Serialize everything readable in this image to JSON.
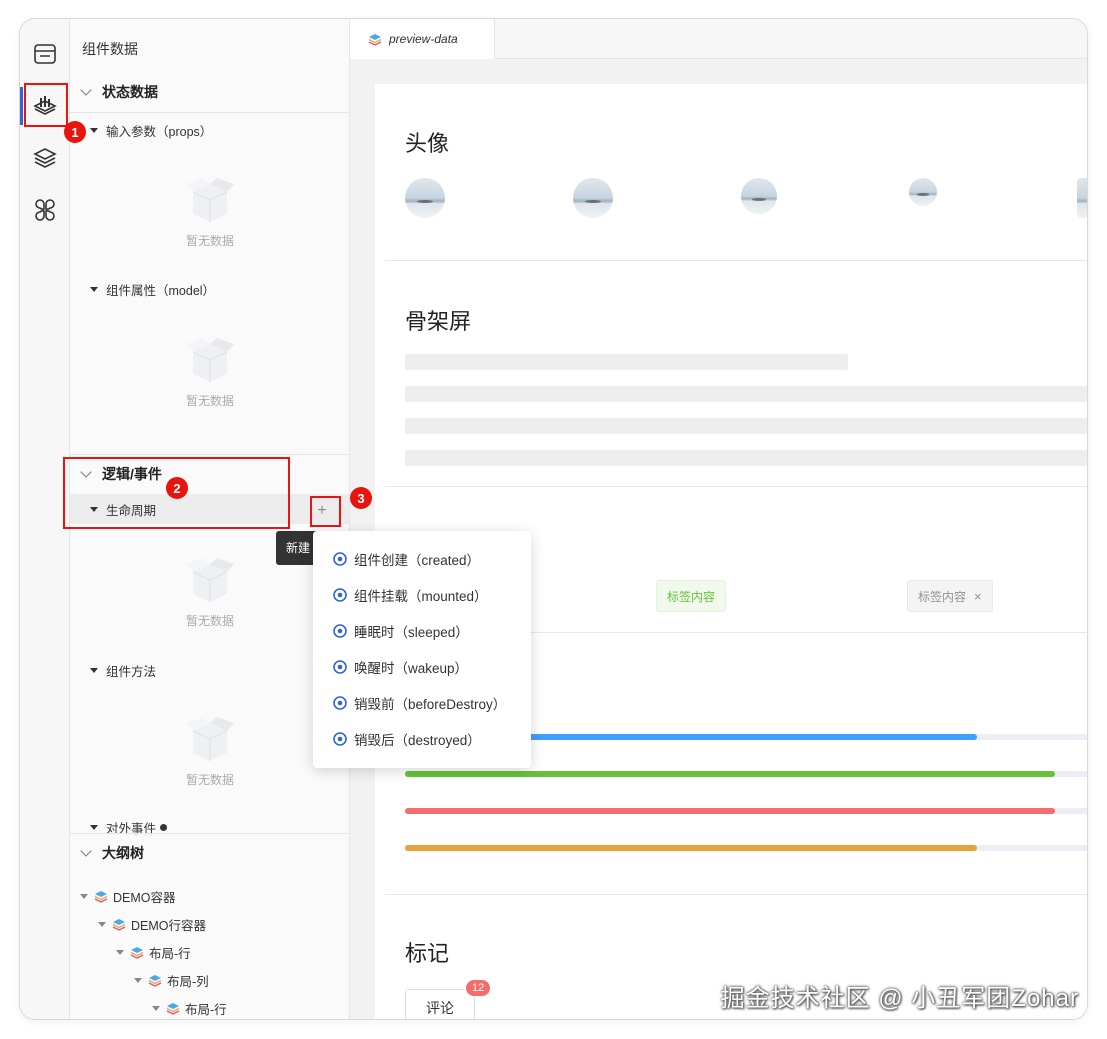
{
  "panel": {
    "title": "组件数据",
    "state_section": "状态数据",
    "props_label": "输入参数（props）",
    "model_label": "组件属性（model）",
    "logic_section": "逻辑/事件",
    "lifecycle_label": "生命周期",
    "methods_label": "组件方法",
    "events_label": "对外事件",
    "empty_text": "暂无数据",
    "plus": "+",
    "tooltip": "新建"
  },
  "outline": {
    "title": "大纲树",
    "items": [
      {
        "label": "DEMO容器"
      },
      {
        "label": "DEMO行容器"
      },
      {
        "label": "布局-行"
      },
      {
        "label": "布局-列"
      },
      {
        "label": "布局-行"
      }
    ]
  },
  "dropdown": {
    "items": [
      {
        "label": "组件创建（created）"
      },
      {
        "label": "组件挂载（mounted）"
      },
      {
        "label": "睡眠时（sleeped）"
      },
      {
        "label": "唤醒时（wakeup）"
      },
      {
        "label": "销毁前（beforeDestroy）"
      },
      {
        "label": "销毁后（destroyed）"
      }
    ]
  },
  "tabs": [
    {
      "label": "preview-data"
    }
  ],
  "preview": {
    "avatar_title": "头像",
    "skeleton_title": "骨架屏",
    "tag_success": "标签内容",
    "tag_closable": "标签内容",
    "tag_close": "×",
    "progress": [
      {
        "percent": 0.88,
        "color": "#409eff"
      },
      {
        "percent": 1.0,
        "color": "#67c23a"
      },
      {
        "percent": 1.0,
        "color": "#f56c6c"
      },
      {
        "percent": 0.88,
        "color": "#e6a23c"
      }
    ],
    "badge_title": "标记",
    "comment_label": "评论",
    "comment_count": "12"
  },
  "annotations": [
    "1",
    "2",
    "3"
  ],
  "watermark": "掘金技术社区 @ 小丑军团Zohar",
  "colors": {
    "accent": "#2f63d9",
    "annotation": "#e8140d"
  }
}
